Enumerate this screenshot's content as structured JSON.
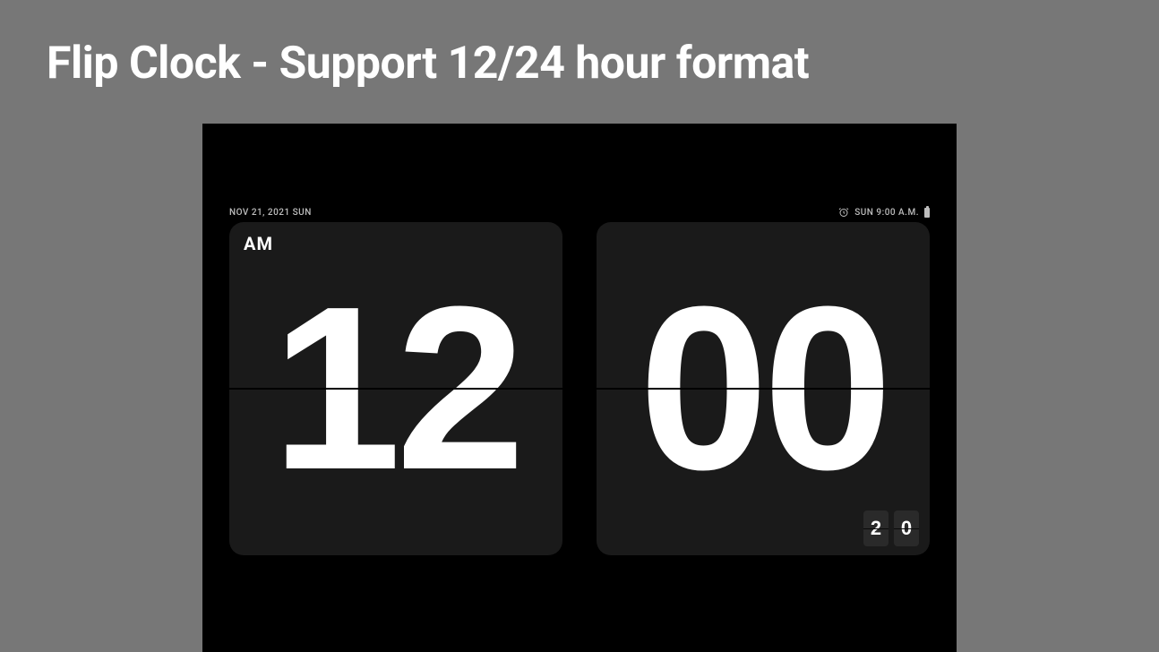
{
  "title": "Flip Clock - Support 12/24 hour format",
  "date_label": "NOV 21, 2021 SUN",
  "alarm_label": "SUN 9:00 A.M.",
  "ampm": "AM",
  "hours": "12",
  "minutes": "00",
  "seconds_tens": "2",
  "seconds_ones": "0"
}
